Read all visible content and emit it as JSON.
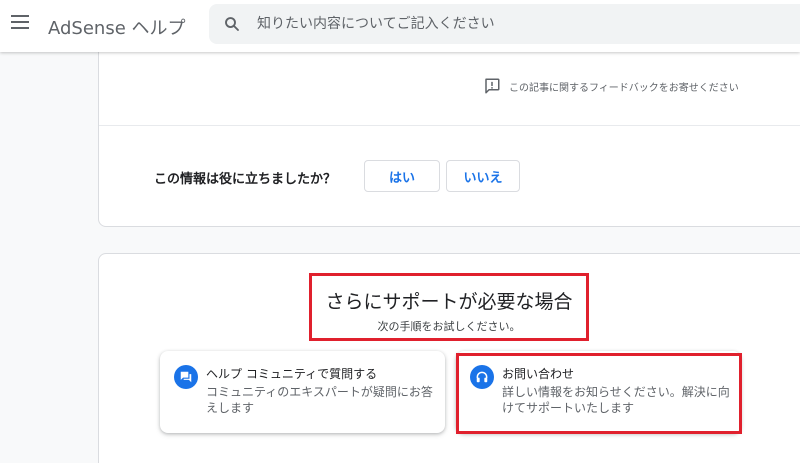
{
  "header": {
    "app_title": "AdSense ヘルプ",
    "search_placeholder": "知りたい内容についてご記入ください"
  },
  "feedback": {
    "link_text": "この記事に関するフィードバックをお寄せください",
    "question": "この情報は役に立ちましたか？",
    "yes_label": "はい",
    "no_label": "いいえ"
  },
  "support": {
    "title": "さらにサポートが必要な場合",
    "subtitle": "次の手順をお試しください。",
    "options": [
      {
        "title": "ヘルプ コミュニティで質問する",
        "description": "コミュニティのエキスパートが疑問にお答えします",
        "icon": "forum-icon"
      },
      {
        "title": "お問い合わせ",
        "description": "詳しい情報をお知らせください。解決に向けてサポートいたします",
        "icon": "headset-icon"
      }
    ]
  },
  "colors": {
    "accent": "#1a73e8",
    "highlight": "#e0202d"
  }
}
